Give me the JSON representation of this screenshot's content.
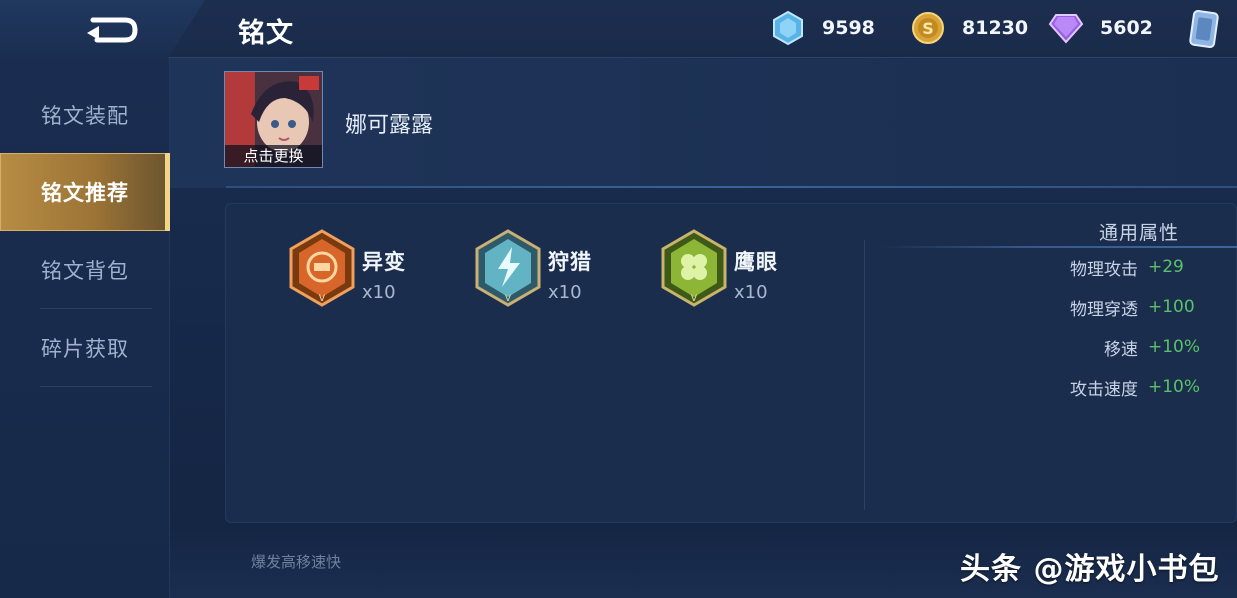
{
  "header": {
    "title": "铭文",
    "currencies": [
      {
        "name": "diamond",
        "icon": "blue-crystal-icon",
        "value": "9598"
      },
      {
        "name": "gold",
        "icon": "gold-coin-icon",
        "value": "81230"
      },
      {
        "name": "gem",
        "icon": "purple-gem-icon",
        "value": "5602"
      }
    ]
  },
  "sidebar": {
    "items": [
      {
        "label": "铭文装配",
        "active": false
      },
      {
        "label": "铭文推荐",
        "active": true
      },
      {
        "label": "铭文背包",
        "active": false
      },
      {
        "label": "碎片获取",
        "active": false
      }
    ]
  },
  "hero": {
    "name": "娜可露露",
    "change_label": "点击更换"
  },
  "runes": [
    {
      "name": "异变",
      "count": "x10",
      "color": "#e07a2c"
    },
    {
      "name": "狩猎",
      "count": "x10",
      "color": "#5fb6c8"
    },
    {
      "name": "鹰眼",
      "count": "x10",
      "color": "#8fb33a"
    }
  ],
  "attributes": {
    "title": "通用属性",
    "items": [
      {
        "label": "物理攻击",
        "value": "+29"
      },
      {
        "label": "物理穿透",
        "value": "+100"
      },
      {
        "label": "移速",
        "value": "+10%"
      },
      {
        "label": "攻击速度",
        "value": "+10%"
      }
    ]
  },
  "footer": {
    "note": "爆发高移速快"
  },
  "watermark": "头条 @游戏小书包",
  "colors": {
    "accent_gold": "#b78c44",
    "value_green": "#59c26a"
  }
}
